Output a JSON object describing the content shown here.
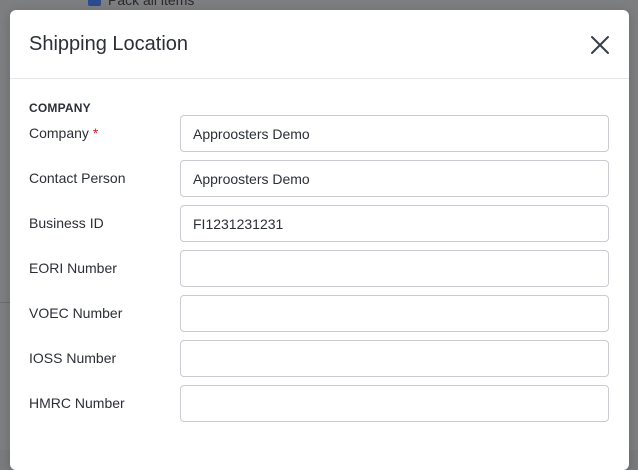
{
  "background": {
    "checkbox_label": "Pack all items"
  },
  "modal": {
    "title": "Shipping Location",
    "section_title": "COMPANY",
    "fields": [
      {
        "label": "Company",
        "required": "*",
        "value": ""
      },
      {
        "label": "Contact Person",
        "value": "Approosters Demo"
      },
      {
        "label": "Business ID",
        "value": "FI1231231231"
      },
      {
        "label": "EORI Number",
        "value": ""
      },
      {
        "label": "VOEC Number",
        "value": ""
      },
      {
        "label": "IOSS Number",
        "value": ""
      },
      {
        "label": "HMRC Number",
        "value": ""
      }
    ],
    "company_value": "Approosters Demo"
  },
  "colors": {
    "required": "#d11f1f",
    "overlay": "#7a7b7d"
  },
  "icons": {
    "close": "close-icon"
  }
}
